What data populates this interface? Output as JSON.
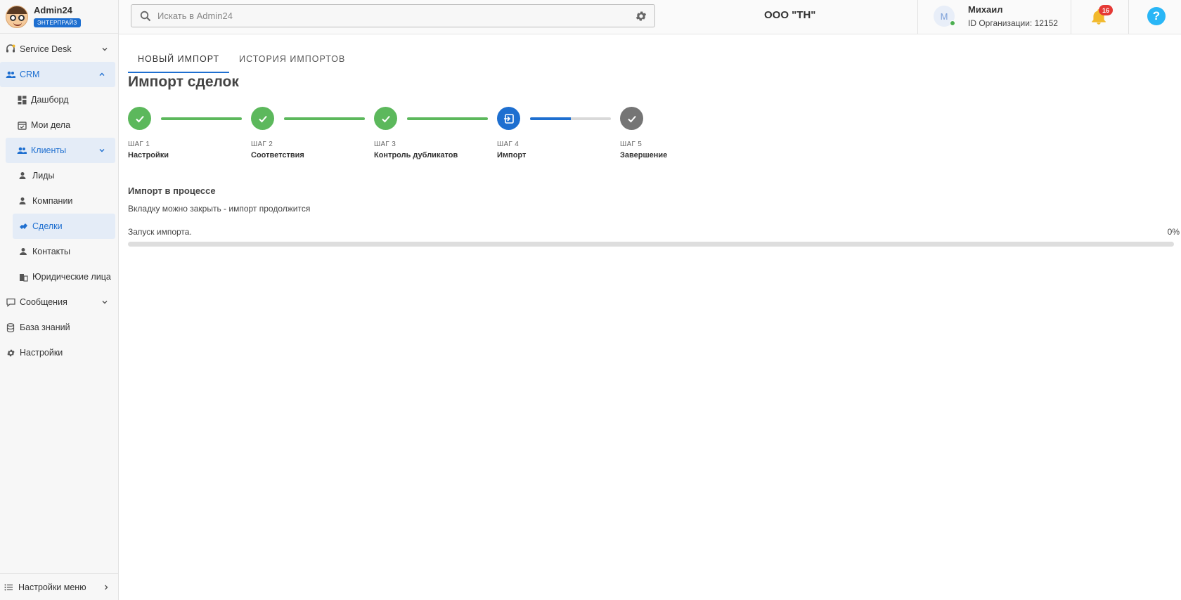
{
  "brand": {
    "name": "Admin24",
    "badge": "ЭНТЕРПРАЙЗ"
  },
  "sidebar": {
    "items": [
      {
        "label": "Service Desk",
        "icon": "headset-icon"
      },
      {
        "label": "CRM",
        "icon": "people-icon"
      },
      {
        "label": "Дашборд",
        "icon": "dashboard-icon"
      },
      {
        "label": "Мои дела",
        "icon": "calendar-icon"
      },
      {
        "label": "Клиенты",
        "icon": "people-icon"
      },
      {
        "label": "Лиды",
        "icon": "person-icon"
      },
      {
        "label": "Компании",
        "icon": "person-icon"
      },
      {
        "label": "Сделки",
        "icon": "handshake-icon"
      },
      {
        "label": "Контакты",
        "icon": "person-icon"
      },
      {
        "label": "Юридические лица",
        "icon": "building-icon"
      },
      {
        "label": "Сообщения",
        "icon": "chat-icon"
      },
      {
        "label": "База знаний",
        "icon": "database-icon"
      },
      {
        "label": "Настройки",
        "icon": "gear-icon"
      }
    ],
    "bottom_label": "Настройки меню"
  },
  "header": {
    "search_placeholder": "Искать в Admin24",
    "org_name": "ООО \"ТН\"",
    "user": {
      "initial": "М",
      "name": "Михаил",
      "org_id": "ID Организации: 12152"
    },
    "notifications_count": "16",
    "help": "?"
  },
  "main": {
    "tabs": [
      {
        "label": "Новый импорт"
      },
      {
        "label": "История импортов"
      }
    ],
    "title": "Импорт сделок",
    "steps": [
      {
        "num": "ШАГ 1",
        "label": "Настройки",
        "state": "done"
      },
      {
        "num": "ШАГ 2",
        "label": "Соответствия",
        "state": "done"
      },
      {
        "num": "ШАГ 3",
        "label": "Контроль дубликатов",
        "state": "done"
      },
      {
        "num": "ШАГ 4",
        "label": "Импорт",
        "state": "current"
      },
      {
        "num": "ШАГ 5",
        "label": "Завершение",
        "state": "pending"
      }
    ],
    "step4_connector_progress": 0.5,
    "status_title": "Импорт в процессе",
    "status_note": "Вкладку можно закрыть - импорт продолжится",
    "progress_label": "Запуск импорта.",
    "progress_percent": "0%",
    "progress_value": 0
  },
  "colors": {
    "accent": "#1e6fd0",
    "success": "#5cb85c",
    "pending": "#757575",
    "badge": "#e53935"
  }
}
